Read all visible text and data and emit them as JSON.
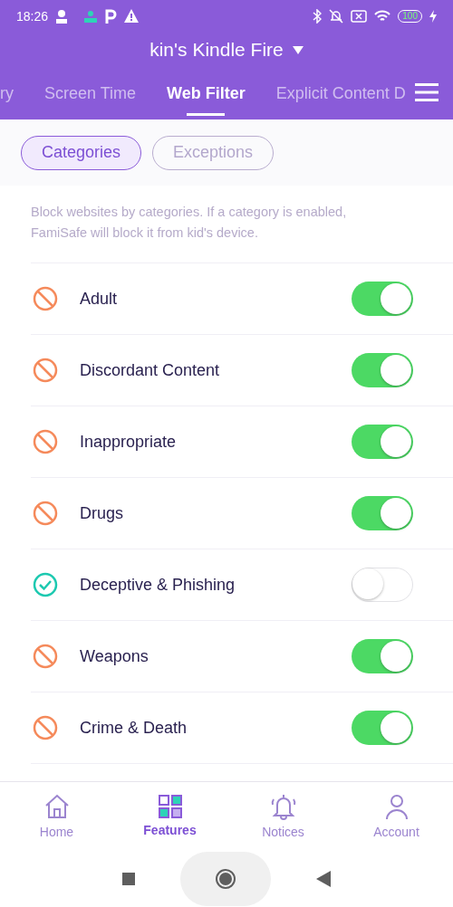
{
  "status_bar": {
    "time": "18:26",
    "battery": "100"
  },
  "header": {
    "title": "kin's Kindle Fire"
  },
  "tabs": [
    {
      "label": "ry",
      "selected": false
    },
    {
      "label": "Screen Time",
      "selected": false
    },
    {
      "label": "Web Filter",
      "selected": true
    },
    {
      "label": "Explicit Content D",
      "selected": false
    }
  ],
  "segments": [
    {
      "label": "Categories",
      "selected": true
    },
    {
      "label": "Exceptions",
      "selected": false
    }
  ],
  "description": "Block websites by categories. If a category is enabled, FamiSafe will block it from kid's device.",
  "categories": [
    {
      "name": "Adult",
      "on": true
    },
    {
      "name": "Discordant Content",
      "on": true
    },
    {
      "name": "Inappropriate",
      "on": true
    },
    {
      "name": "Drugs",
      "on": true
    },
    {
      "name": "Deceptive & Phishing",
      "on": false
    },
    {
      "name": "Weapons",
      "on": true
    },
    {
      "name": "Crime & Death",
      "on": true
    }
  ],
  "bottom_nav": [
    {
      "label": "Home",
      "kind": "home",
      "selected": false
    },
    {
      "label": "Features",
      "kind": "features",
      "selected": true
    },
    {
      "label": "Notices",
      "kind": "bell",
      "selected": false
    },
    {
      "label": "Account",
      "kind": "person",
      "selected": false
    }
  ]
}
